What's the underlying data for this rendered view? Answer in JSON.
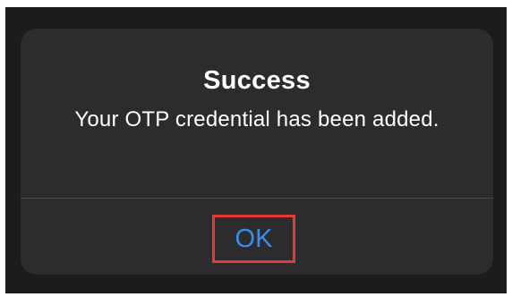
{
  "alert": {
    "title": "Success",
    "message": "Your OTP credential has been added.",
    "ok_label": "OK"
  },
  "colors": {
    "backdrop": "#1c1c1e",
    "alert_background": "#2c2c2e",
    "text": "#ffffff",
    "button_text": "#3b8ded",
    "highlight_border": "#e53935",
    "divider": "#4a4a4c"
  }
}
